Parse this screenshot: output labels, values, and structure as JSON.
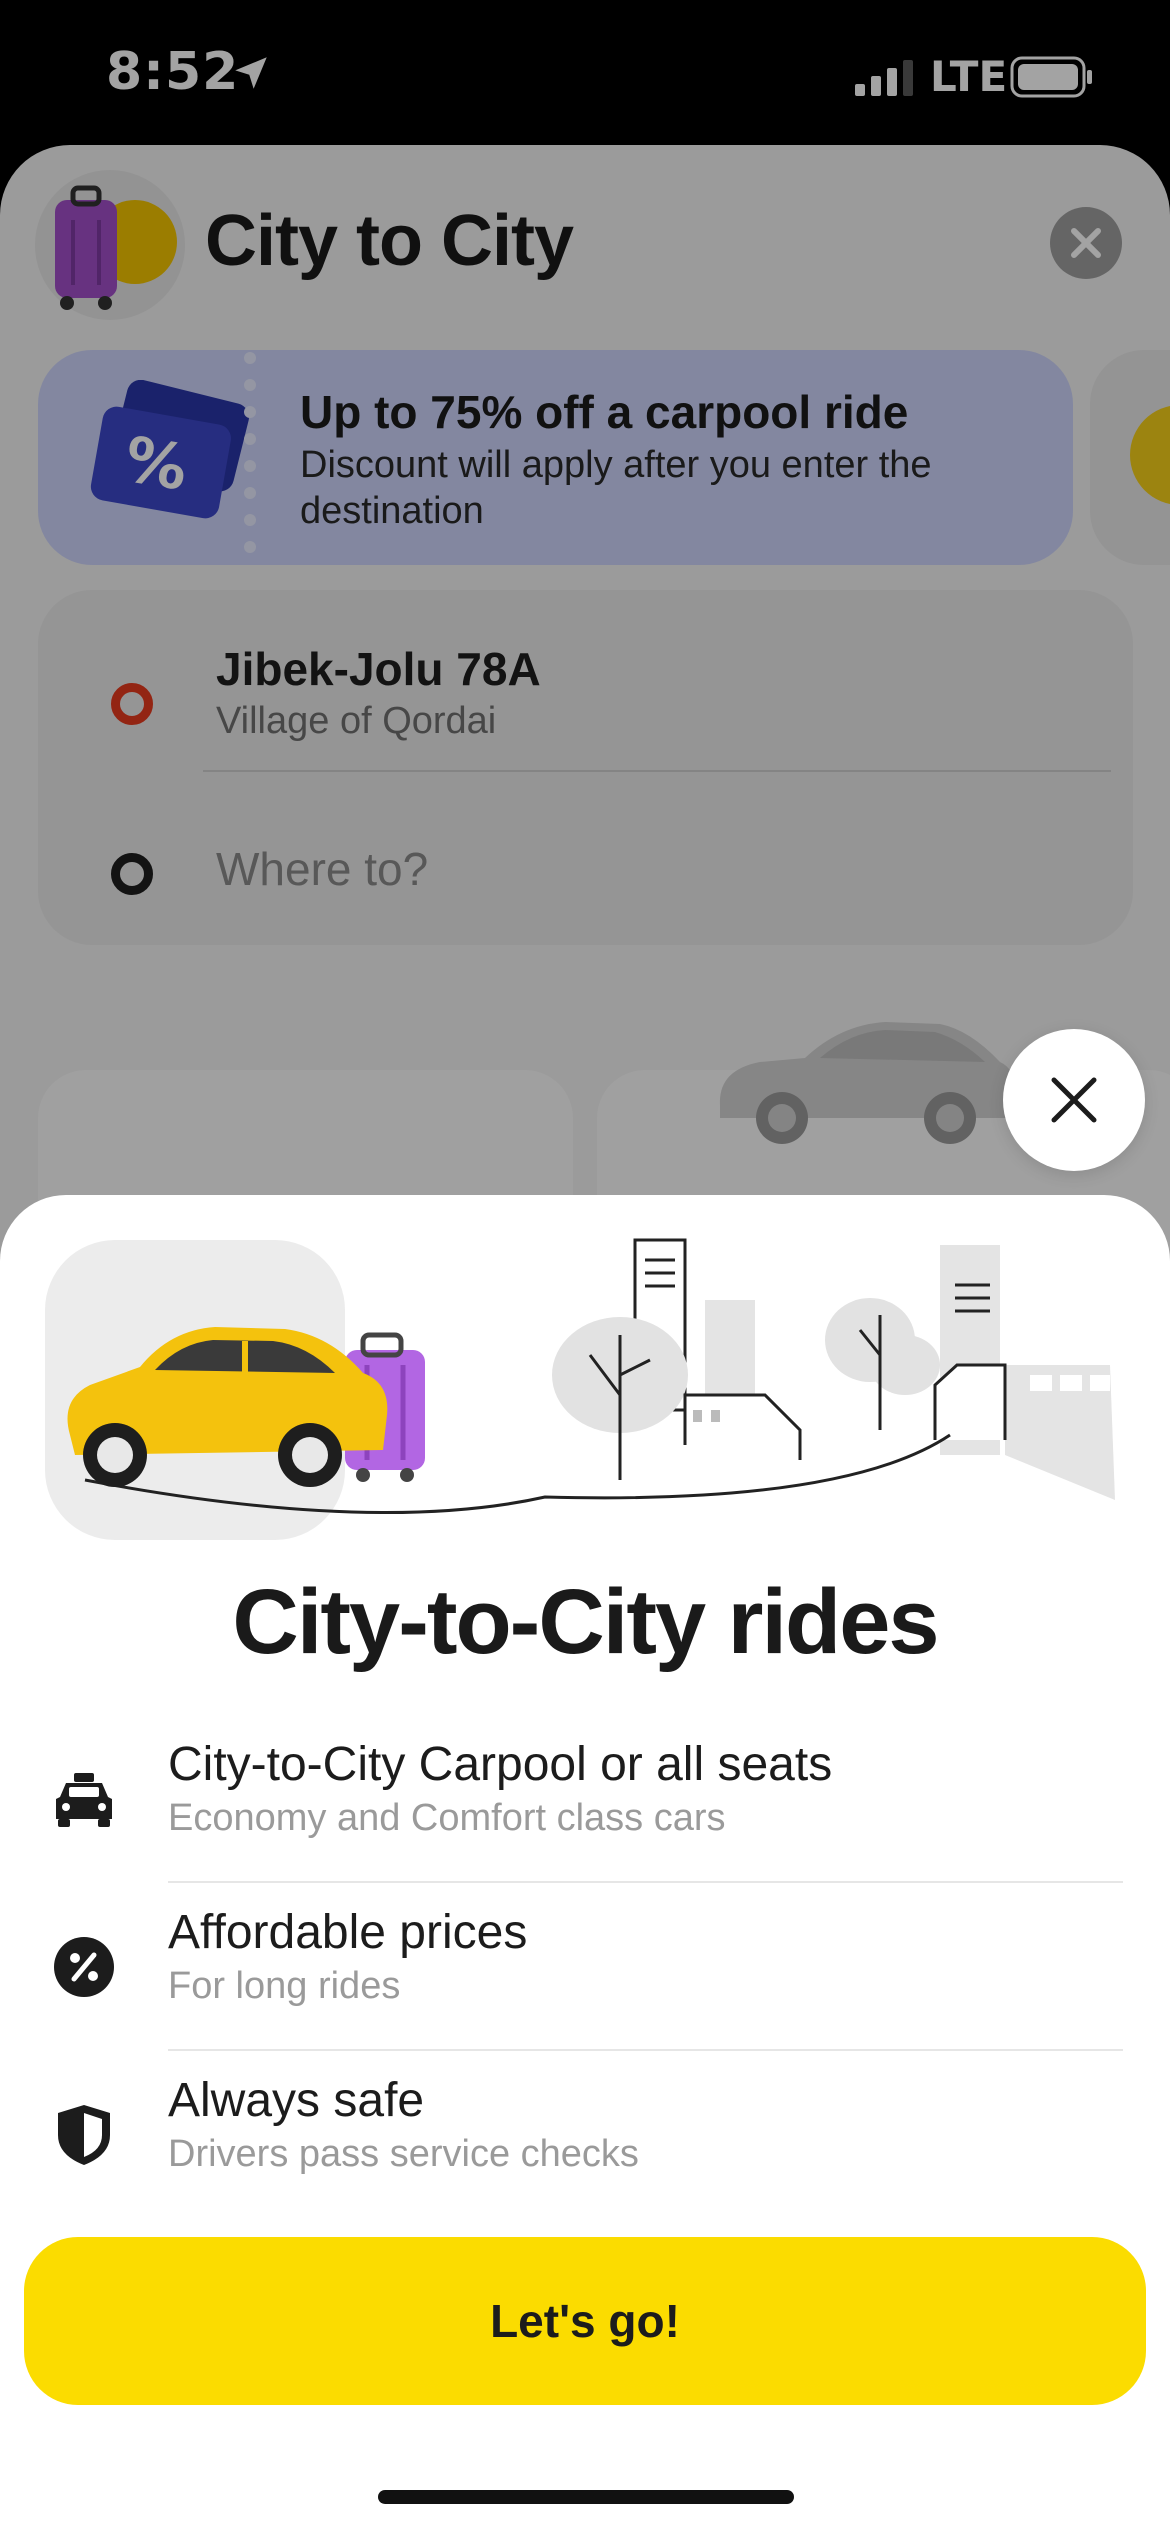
{
  "status_bar": {
    "time": "8:52",
    "network": "LTE"
  },
  "background": {
    "title": "City to City",
    "promo": {
      "title": "Up to 75% off a carpool ride",
      "subtitle": "Discount will apply after you enter the destination",
      "badge": "%"
    },
    "route": {
      "from_title": "Jibek-Jolu 78A",
      "from_subtitle": "Village of Qordai",
      "to_placeholder": "Where to?"
    }
  },
  "modal": {
    "title": "City-to-City rides",
    "features": [
      {
        "icon": "taxi-icon",
        "title": "City-to-City Carpool or all seats",
        "subtitle": "Economy and Comfort class cars"
      },
      {
        "icon": "percent-icon",
        "title": "Affordable prices",
        "subtitle": "For long rides"
      },
      {
        "icon": "shield-icon",
        "title": "Always safe",
        "subtitle": "Drivers pass service checks"
      }
    ],
    "cta_label": "Let's go!"
  },
  "colors": {
    "accent": "#fbdc00",
    "promo_bg": "#cdd4fb",
    "route_from": "#e63a1e"
  }
}
